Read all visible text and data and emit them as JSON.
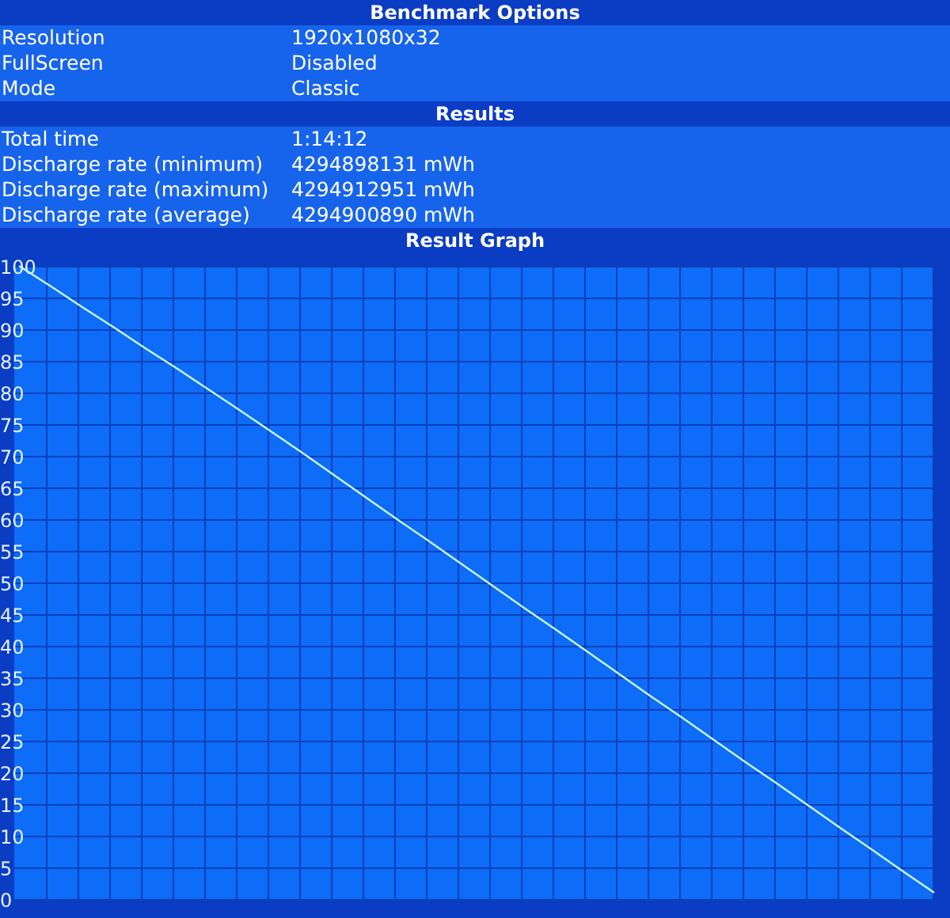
{
  "sections": [
    {
      "title": "Benchmark Options",
      "rows": [
        {
          "label": "Resolution",
          "value": "1920x1080x32"
        },
        {
          "label": "FullScreen",
          "value": "Disabled"
        },
        {
          "label": "Mode",
          "value": "Classic"
        }
      ]
    },
    {
      "title": "Results",
      "rows": [
        {
          "label": "Total time",
          "value": "1:14:12"
        },
        {
          "label": "Discharge rate (minimum)",
          "value": "4294898131 mWh"
        },
        {
          "label": "Discharge rate (maximum)",
          "value": "4294912951 mWh"
        },
        {
          "label": "Discharge rate (average)",
          "value": "4294900890 mWh"
        }
      ]
    }
  ],
  "graph": {
    "title": "Result Graph",
    "chart_data": {
      "type": "line",
      "grid": true,
      "ylim": [
        0,
        100
      ],
      "yticks": [
        0,
        5,
        10,
        15,
        20,
        25,
        30,
        35,
        40,
        45,
        50,
        55,
        60,
        65,
        70,
        75,
        80,
        85,
        90,
        95,
        100
      ],
      "series": [
        {
          "color": "#c8f5e6",
          "values": [
            100,
            96.8,
            93.5,
            90.3,
            87.0,
            83.8,
            80.5,
            77.2,
            73.8,
            70.4,
            66.9,
            63.4,
            59.9,
            56.5,
            53.0,
            49.5,
            46.0,
            42.6,
            39.1,
            35.6,
            32.1,
            28.7,
            25.2,
            21.7,
            18.3,
            14.8,
            11.3,
            7.9,
            4.4,
            1.0
          ]
        }
      ]
    }
  }
}
